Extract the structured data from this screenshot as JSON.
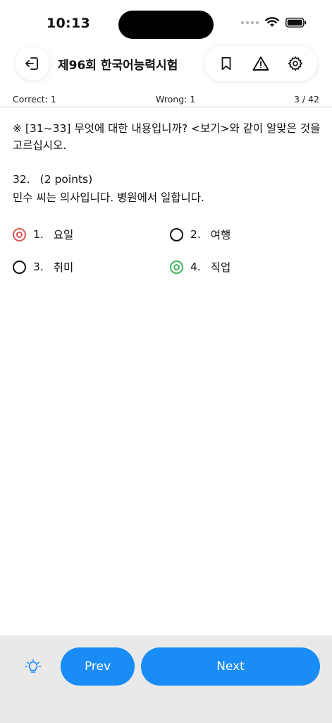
{
  "status_bar": {
    "time": "10:13"
  },
  "nav": {
    "title": "제96회 한국어능력시험",
    "icons": [
      "exit-icon",
      "bookmark-icon",
      "warning-icon",
      "gear-icon"
    ]
  },
  "score": {
    "correct": "Correct: 1",
    "wrong": "Wrong: 1",
    "progress": "3 / 42"
  },
  "question": {
    "instruction": "※ [31~33] 무엇에 대한 내용입니까? <보기>와 같이 알맞은 것을 고르십시오.",
    "number": "32.",
    "points": "(2 points)",
    "text": "민수 씨는 의사입니다. 병원에서 일합니다."
  },
  "options": [
    {
      "num": "1.",
      "label": "요일",
      "state": "wrong"
    },
    {
      "num": "2.",
      "label": "여행",
      "state": "none"
    },
    {
      "num": "3.",
      "label": "취미",
      "state": "none"
    },
    {
      "num": "4.",
      "label": "직업",
      "state": "correct"
    }
  ],
  "colors": {
    "accent": "#1a8cf5",
    "wrong": "#e25656",
    "correct": "#3fb560",
    "bottom_bar": "#e9e9e9"
  },
  "footer": {
    "prev_label": "Prev",
    "next_label": "Next",
    "hint_icon": "lightbulb-icon"
  }
}
